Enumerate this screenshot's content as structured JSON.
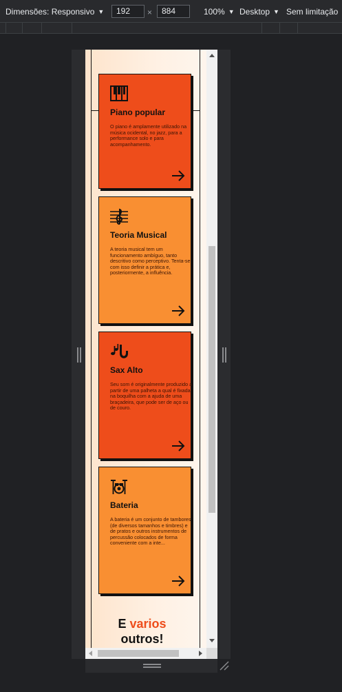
{
  "toolbar": {
    "dimensions_label": "Dimensões: Responsivo",
    "width_value": "192",
    "times": "×",
    "height_value": "884",
    "zoom_label": "100%",
    "device_type_label": "Desktop",
    "throttle_label": "Sem limitação"
  },
  "cards": [
    {
      "title": "Piano popular",
      "text": "O piano é amplamente utilizado na música ocidental, no jazz, para a performance solo e para acompanhamento.",
      "icon": "piano-icon",
      "color": "#ee4d1b"
    },
    {
      "title": "Teoria Musical",
      "text": "A teoria musical tem um funcionamento ambíguo, tanto descritivo como perceptivo. Tenta-se com isso definir a prática e, posteriormente, a influência.",
      "icon": "treble-clef-icon",
      "color": "#f98f32"
    },
    {
      "title": "Sax Alto",
      "text": "Seu som é originalmente produzido a partir de uma palheta a qual é fixada na boquilha com a ajuda de uma braçadeira, que pode ser de aço ou de couro.",
      "icon": "saxophone-icon",
      "color": "#ee4d1b"
    },
    {
      "title": "Bateria",
      "text": "A bateria é um conjunto de tambores (de diversos tamanhos e timbres) e de pratos e outros instrumentos de percussão colocados de forma conveniente com a inte...",
      "icon": "drum-kit-icon",
      "color": "#f98f32"
    }
  ],
  "footer": {
    "prefix": "E",
    "highlight": "varios",
    "suffix": "outros!"
  },
  "colors": {
    "accent_red": "#ee4d1b",
    "accent_orange": "#f98f32"
  }
}
